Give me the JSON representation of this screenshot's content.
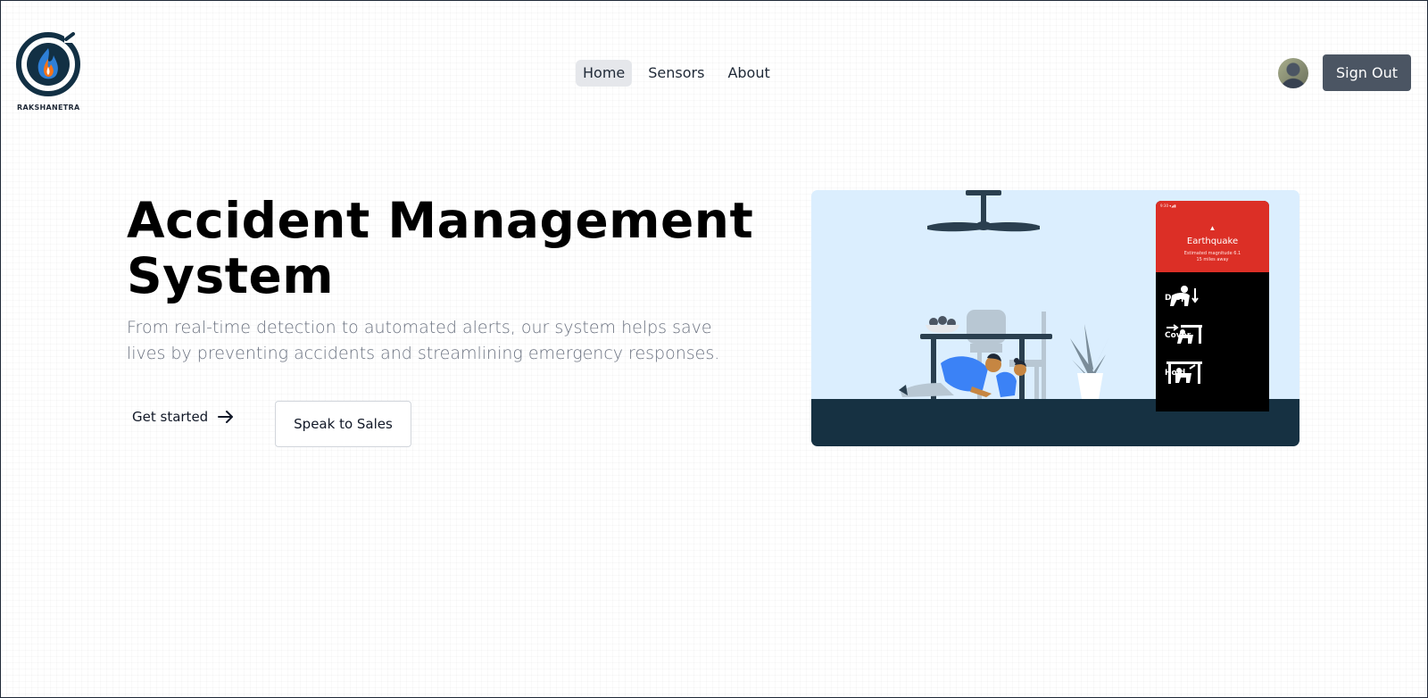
{
  "brand": {
    "name": "RAKSHANETRA",
    "icon": "flame-logo-icon",
    "colors": {
      "ring": "#123044",
      "flame_outer": "#2e7fd6",
      "flame_inner": "#f97316"
    }
  },
  "nav": {
    "items": [
      {
        "label": "Home",
        "active": true
      },
      {
        "label": "Sensors",
        "active": false
      },
      {
        "label": "About",
        "active": false
      }
    ]
  },
  "header": {
    "avatar_icon": "user-avatar",
    "signout_label": "Sign Out"
  },
  "hero": {
    "title": "Accident Management System",
    "subtitle": "From real-time detection to automated alerts, our system helps save lives by preventing accidents and streamlining emergency responses.",
    "cta_primary": "Get started",
    "cta_primary_icon": "arrow-right-icon",
    "cta_secondary": "Speak to Sales"
  },
  "illustration": {
    "alert": {
      "title": "Earthquake",
      "detail_line1": "Estimated magnitude 6.1",
      "detail_line2": "15 miles away",
      "icon": "warning-triangle-icon"
    },
    "steps": [
      "Drop",
      "Cover",
      "Hold"
    ],
    "colors": {
      "background": "#dbeefe",
      "floor": "#163142",
      "alert": "#dc2f26",
      "people": "#3b82f6"
    }
  }
}
